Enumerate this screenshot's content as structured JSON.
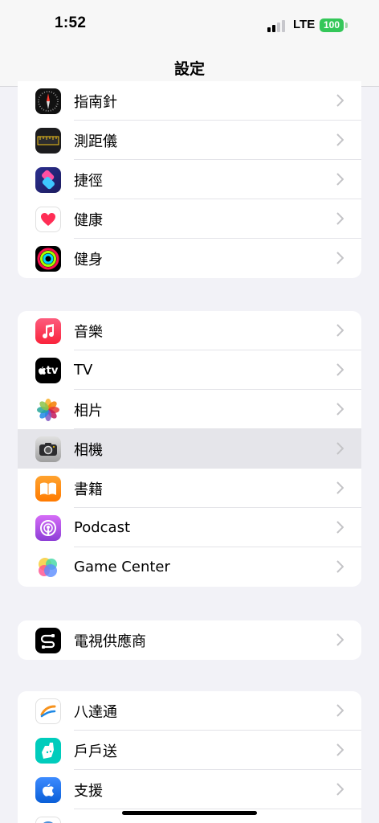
{
  "status": {
    "time": "1:52",
    "network": "LTE",
    "battery": "100"
  },
  "nav": {
    "title": "設定"
  },
  "groups": [
    {
      "items": [
        {
          "label": "指南針",
          "icon": "compass-icon"
        },
        {
          "label": "測距儀",
          "icon": "measure-icon"
        },
        {
          "label": "捷徑",
          "icon": "shortcuts-icon"
        },
        {
          "label": "健康",
          "icon": "health-icon"
        },
        {
          "label": "健身",
          "icon": "fitness-icon"
        }
      ]
    },
    {
      "items": [
        {
          "label": "音樂",
          "icon": "music-icon"
        },
        {
          "label": "TV",
          "icon": "tv-icon",
          "icon_text": "tv"
        },
        {
          "label": "相片",
          "icon": "photos-icon"
        },
        {
          "label": "相機",
          "icon": "camera-icon",
          "highlighted": true
        },
        {
          "label": "書籍",
          "icon": "books-icon"
        },
        {
          "label": "Podcast",
          "icon": "podcast-icon"
        },
        {
          "label": "Game Center",
          "icon": "game-center-icon"
        }
      ]
    },
    {
      "items": [
        {
          "label": "電視供應商",
          "icon": "tv-provider-icon"
        }
      ]
    },
    {
      "items": [
        {
          "label": "八達通",
          "icon": "octopus-icon"
        },
        {
          "label": "戶戶送",
          "icon": "deliveroo-icon"
        },
        {
          "label": "支援",
          "icon": "apple-support-icon"
        }
      ]
    }
  ],
  "colors": {
    "background": "#f2f2f7",
    "highlight": "#e5e5ea",
    "battery": "#34c759"
  }
}
